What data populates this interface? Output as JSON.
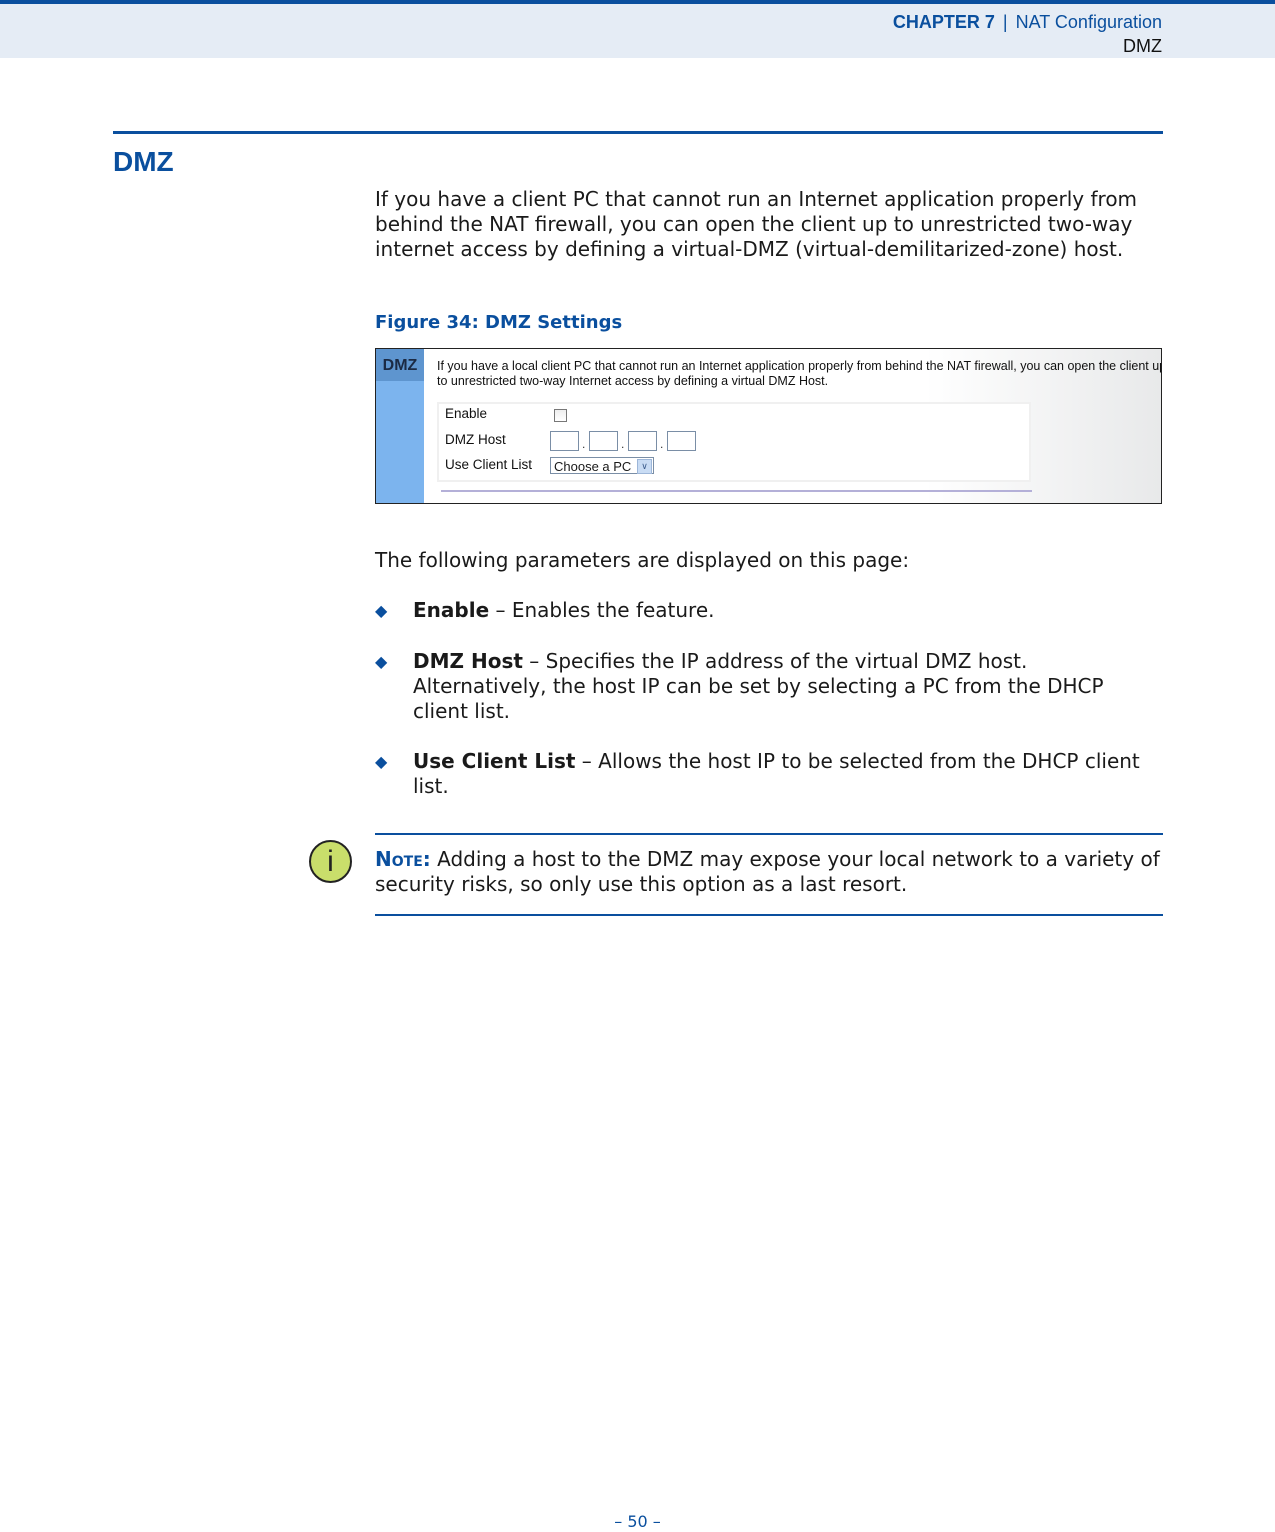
{
  "header": {
    "chapter": "CHAPTER 7",
    "separator": "|",
    "chapter_title": "NAT Configuration",
    "section": "DMZ"
  },
  "section": {
    "title": "DMZ",
    "intro": "If you have a client PC that cannot run an Internet application properly from behind the NAT firewall, you can open the client up to unrestricted two-way internet access by defining a virtual-DMZ (virtual-demilitarized-zone) host."
  },
  "figure": {
    "caption": "Figure 34:  DMZ Settings",
    "panel_title": "DMZ",
    "description_line1": "If you have a local client PC that cannot run an Internet application properly from behind the NAT firewall, you can open the client up",
    "description_line2": "to unrestricted two-way Internet access by defining a virtual DMZ Host.",
    "enable_label": "Enable",
    "enable_checked": false,
    "dmz_host_label": "DMZ Host",
    "ip_octets": [
      "",
      "",
      "",
      ""
    ],
    "ip_separator": ".",
    "client_list_label": "Use Client List",
    "client_list_selected": "Choose a PC"
  },
  "params_intro": "The following parameters are displayed on this page:",
  "bullets": [
    {
      "term": "Enable",
      "desc": " – Enables the feature."
    },
    {
      "term": "DMZ Host",
      "desc": " – Specifies the IP address of the virtual DMZ host. Alternatively, the host IP can be set by selecting a PC from the DHCP client list."
    },
    {
      "term": "Use Client List",
      "desc": " – Allows the host IP to be selected from the DHCP client list."
    }
  ],
  "bullet_marker": "◆",
  "note": {
    "icon": "info-icon",
    "icon_glyph": "i",
    "label": "Note:",
    "text": " Adding a host to the DMZ may expose your local network to a variety of security risks, so only use this option as a last resort."
  },
  "footer": {
    "page_number": "–  50  –"
  }
}
